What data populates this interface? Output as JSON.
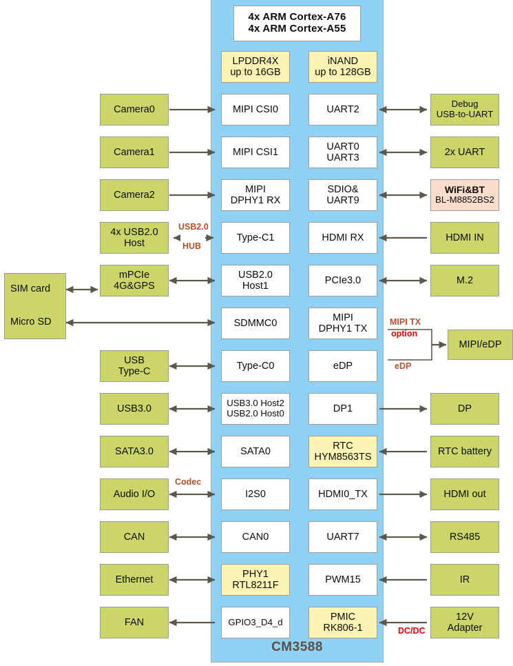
{
  "diagram": {
    "title": "CM3588",
    "colors": {
      "soc_panel": "#8fd2f4",
      "green": "#ccd668",
      "yellow": "#fdf4b3",
      "pink": "#fadccb",
      "white": "#ffffff",
      "arrow": "#5d564a",
      "annotation_brown": "#b5502a",
      "annotation_red": "#f00000",
      "title_text": "#595144"
    }
  },
  "cpu": {
    "line1": "4x ARM Cortex-A76",
    "line2": "4x ARM Cortex-A55"
  },
  "memory": [
    {
      "line1": "LPDDR4X",
      "line2": "up to 16GB"
    },
    {
      "line1": "iNAND",
      "line2": "up to 128GB"
    }
  ],
  "soc_left_blocks": [
    {
      "line1": "MIPI CSI0",
      "line2": ""
    },
    {
      "line1": "MIPI CSI1",
      "line2": ""
    },
    {
      "line1": "MIPI",
      "line2": "DPHY1 RX"
    },
    {
      "line1": "Type-C1",
      "line2": ""
    },
    {
      "line1": "USB2.0",
      "line2": "Host1"
    },
    {
      "line1": "SDMMC0",
      "line2": ""
    },
    {
      "line1": "Type-C0",
      "line2": ""
    },
    {
      "line1": "USB3.0 Host2",
      "line2": "USB2.0 Host0"
    },
    {
      "line1": "SATA0",
      "line2": ""
    },
    {
      "line1": "I2S0",
      "line2": ""
    },
    {
      "line1": "CAN0",
      "line2": ""
    },
    {
      "line1": "PHY1",
      "line2": "RTL8211F"
    },
    {
      "line1": "GPIO3_D4_d",
      "line2": ""
    }
  ],
  "soc_right_blocks": [
    {
      "line1": "UART2",
      "line2": ""
    },
    {
      "line1": "UART0",
      "line2": "UART3"
    },
    {
      "line1": "SDIO&",
      "line2": "UART9"
    },
    {
      "line1": "HDMI RX",
      "line2": ""
    },
    {
      "line1": "PCIe3.0",
      "line2": ""
    },
    {
      "line1": "MIPI",
      "line2": "DPHY1 TX"
    },
    {
      "line1": "eDP",
      "line2": ""
    },
    {
      "line1": "DP1",
      "line2": ""
    },
    {
      "line1": "RTC",
      "line2": "HYM8563TS"
    },
    {
      "line1": "HDMI0_TX",
      "line2": ""
    },
    {
      "line1": "UART7",
      "line2": ""
    },
    {
      "line1": "PWM15",
      "line2": ""
    },
    {
      "line1": "PMIC",
      "line2": "RK806-1"
    }
  ],
  "peripherals_left": [
    {
      "line1": "Camera0",
      "line2": ""
    },
    {
      "line1": "Camera1",
      "line2": ""
    },
    {
      "line1": "Camera2",
      "line2": ""
    },
    {
      "line1": "4x USB2.0",
      "line2": "Host"
    },
    {
      "line1": "mPCIe",
      "line2": "4G&GPS"
    },
    {
      "line1": "USB",
      "line2": "Type-C"
    },
    {
      "line1": "USB3.0",
      "line2": ""
    },
    {
      "line1": "SATA3.0",
      "line2": ""
    },
    {
      "line1": "Audio I/O",
      "line2": ""
    },
    {
      "line1": "CAN",
      "line2": ""
    },
    {
      "line1": "Ethernet",
      "line2": ""
    },
    {
      "line1": "FAN",
      "line2": ""
    }
  ],
  "peripherals_right": [
    {
      "line1": "Debug",
      "line2": "USB-to-UART"
    },
    {
      "line1": "2x UART",
      "line2": ""
    },
    {
      "line1": "WiFi&BT",
      "line2": "BL-M8852BS2"
    },
    {
      "line1": "HDMI IN",
      "line2": ""
    },
    {
      "line1": "M.2",
      "line2": ""
    },
    {
      "line1": "MIPI/eDP",
      "line2": ""
    },
    {
      "line1": "DP",
      "line2": ""
    },
    {
      "line1": "RTC battery",
      "line2": ""
    },
    {
      "line1": "HDMI out",
      "line2": ""
    },
    {
      "line1": "RS485",
      "line2": ""
    },
    {
      "line1": "IR",
      "line2": ""
    },
    {
      "line1": "12V",
      "line2": "Adapter"
    }
  ],
  "storage_box": {
    "label1": "SIM card",
    "label2": "Micro SD"
  },
  "annotations": {
    "usb_hub_top": "USB2.0",
    "usb_hub_bottom": "HUB",
    "codec": "Codec",
    "mipi_tx": "MIPI TX",
    "option": "option",
    "edp": "eDP",
    "dcdc": "DC/DC"
  }
}
